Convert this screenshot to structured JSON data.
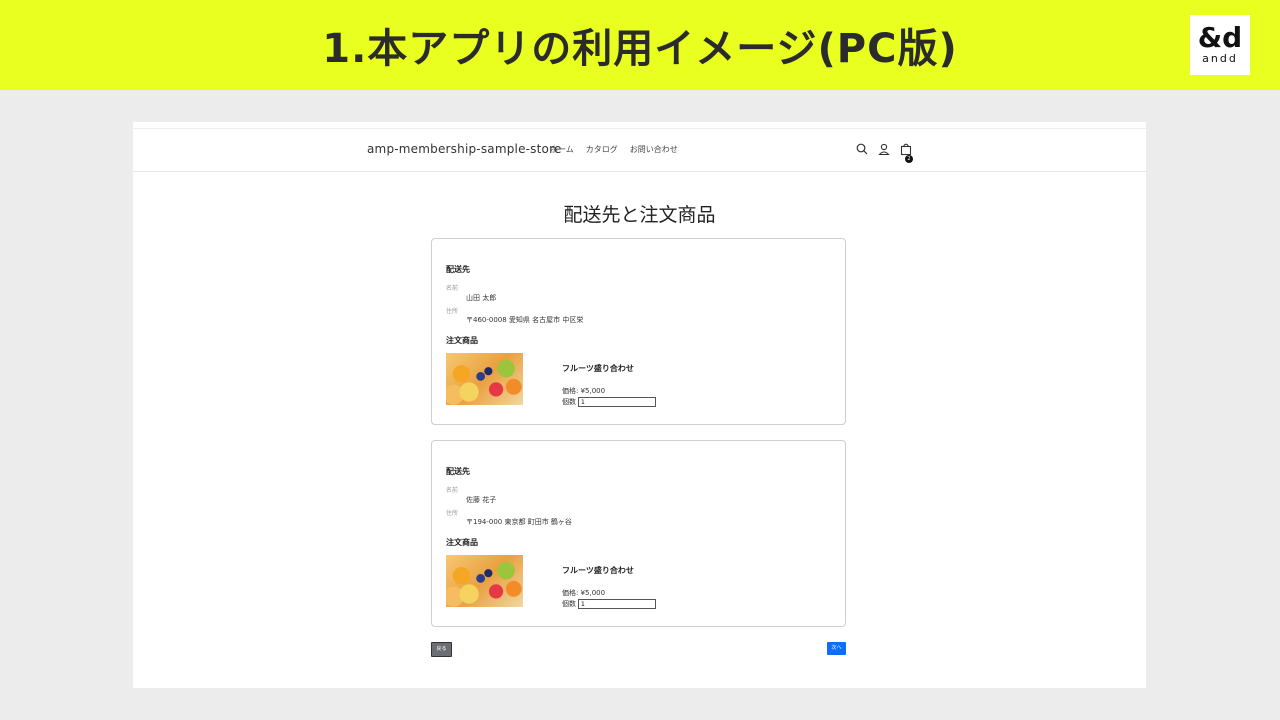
{
  "banner": {
    "title": "1.本アプリの利用イメージ(PC版)",
    "logo_mark": "&d",
    "logo_text": "andd"
  },
  "header": {
    "store_name": "amp-membership-sample-store",
    "nav": [
      "ホーム",
      "カタログ",
      "お問い合わせ"
    ],
    "cart_count": "2"
  },
  "page": {
    "title": "配送先と注文商品"
  },
  "orders": [
    {
      "shipping_title": "配送先",
      "name_label": "名前",
      "name": "山田 太郎",
      "address_label": "住所",
      "address": "〒460-0008 愛知県 名古屋市 中区栄",
      "items_title": "注文商品",
      "product_name": "フルーツ盛り合わせ",
      "price": "価格: ¥5,000",
      "qty_label": "個数",
      "qty": "1"
    },
    {
      "shipping_title": "配送先",
      "name_label": "名前",
      "name": "佐藤 花子",
      "address_label": "住所",
      "address": "〒194-000 東京都 町田市 鶴ヶ谷",
      "items_title": "注文商品",
      "product_name": "フルーツ盛り合わせ",
      "price": "価格: ¥5,000",
      "qty_label": "個数",
      "qty": "1"
    }
  ],
  "buttons": {
    "back": "戻る",
    "next": "次へ"
  },
  "icons": {
    "search": "search-icon",
    "account": "user-icon",
    "cart": "cart-icon"
  }
}
